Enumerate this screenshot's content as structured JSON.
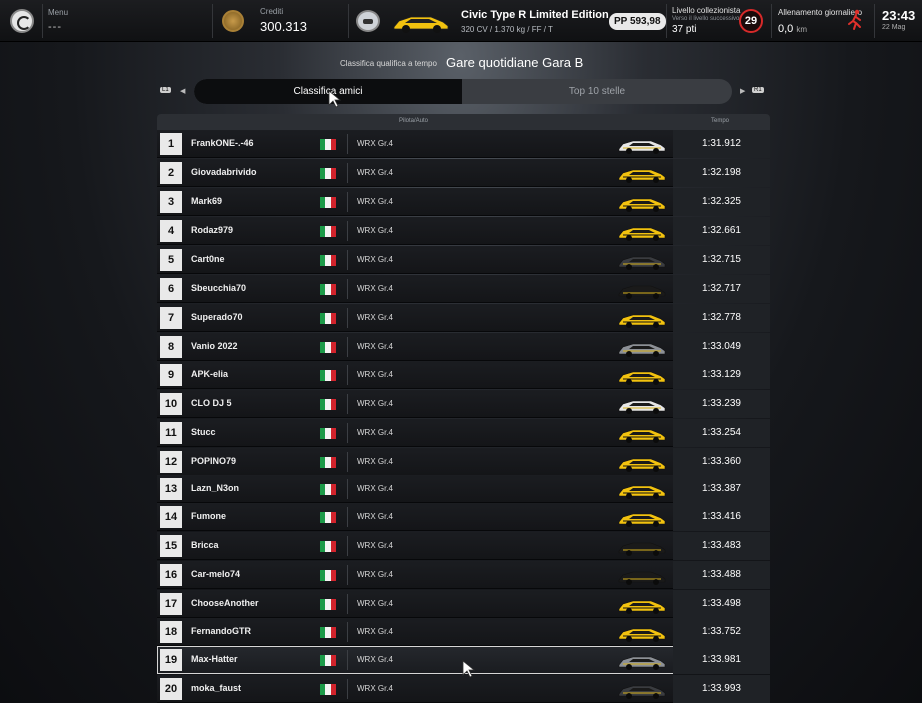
{
  "topbar": {
    "menu_label": "Menu",
    "menu_value": "---",
    "credits_label": "Crediti",
    "credits_value": "300.313",
    "car_name": "Civic Type R Limited Edition ...",
    "car_specs": "320 CV / 1.370 kg / FF / T",
    "pp_value": "PP 593,98",
    "collector_title": "Livello collezionista",
    "collector_sub": "Verso il livello successivo",
    "collector_points": "37 pti",
    "collector_level": "29",
    "training_label": "Allenamento giornaliero",
    "training_value": "0,0",
    "training_unit": "km",
    "clock_time": "23:43",
    "clock_date": "22 Mag"
  },
  "header": {
    "subtitle": "Classifica qualifica a tempo",
    "title": "Gare quotidiane Gara B"
  },
  "tabs": {
    "friends": "Classifica amici",
    "top10": "Top 10 stelle",
    "left_key": "L1",
    "right_key": "R1"
  },
  "table": {
    "col_driver": "Pilota/Auto",
    "col_time": "Tempo",
    "rows": [
      {
        "pos": "1",
        "name": "FrankONE-.-46",
        "car": "WRX Gr.4",
        "time": "1:31.912",
        "livery": "white"
      },
      {
        "pos": "2",
        "name": "Giovadabrivido",
        "car": "WRX Gr.4",
        "time": "1:32.198",
        "livery": "yellow"
      },
      {
        "pos": "3",
        "name": "Mark69",
        "car": "WRX Gr.4",
        "time": "1:32.325",
        "livery": "yellow"
      },
      {
        "pos": "4",
        "name": "Rodaz979",
        "car": "WRX Gr.4",
        "time": "1:32.661",
        "livery": "yellow"
      },
      {
        "pos": "5",
        "name": "Cart0ne",
        "car": "WRX Gr.4",
        "time": "1:32.715",
        "livery": "dark"
      },
      {
        "pos": "6",
        "name": "Sbeucchia70",
        "car": "WRX Gr.4",
        "time": "1:32.717",
        "livery": "black"
      },
      {
        "pos": "7",
        "name": "Superado70",
        "car": "WRX Gr.4",
        "time": "1:32.778",
        "livery": "yellow"
      },
      {
        "pos": "8",
        "name": "Vanio 2022",
        "car": "WRX Gr.4",
        "time": "1:33.049",
        "livery": "grey"
      },
      {
        "pos": "9",
        "name": "APK-elia",
        "car": "WRX Gr.4",
        "time": "1:33.129",
        "livery": "yellow"
      },
      {
        "pos": "10",
        "name": "CLO DJ 5",
        "car": "WRX Gr.4",
        "time": "1:33.239",
        "livery": "white"
      },
      {
        "pos": "11",
        "name": "Stucc",
        "car": "WRX Gr.4",
        "time": "1:33.254",
        "livery": "yellow"
      },
      {
        "pos": "12",
        "name": "POPINO79",
        "car": "WRX Gr.4",
        "time": "1:33.360",
        "livery": "yellow"
      },
      {
        "pos": "13",
        "name": "Lazn_N3on",
        "car": "WRX Gr.4",
        "time": "1:33.387",
        "livery": "yellow"
      },
      {
        "pos": "14",
        "name": "Fumone",
        "car": "WRX Gr.4",
        "time": "1:33.416",
        "livery": "yellow"
      },
      {
        "pos": "15",
        "name": "Bricca",
        "car": "WRX Gr.4",
        "time": "1:33.483",
        "livery": "black"
      },
      {
        "pos": "16",
        "name": "Car-melo74",
        "car": "WRX Gr.4",
        "time": "1:33.488",
        "livery": "black"
      },
      {
        "pos": "17",
        "name": "ChooseAnother",
        "car": "WRX Gr.4",
        "time": "1:33.498",
        "livery": "yellow"
      },
      {
        "pos": "18",
        "name": "FernandoGTR",
        "car": "WRX Gr.4",
        "time": "1:33.752",
        "livery": "yellow"
      },
      {
        "pos": "19",
        "name": "Max-Hatter",
        "car": "WRX Gr.4",
        "time": "1:33.981",
        "livery": "grey"
      },
      {
        "pos": "20",
        "name": "moka_faust",
        "car": "WRX Gr.4",
        "time": "1:33.993",
        "livery": "dark"
      }
    ],
    "selected_pos": "19"
  },
  "colors": {
    "accent_red": "#d62a2a",
    "flag_green": "#1c9a48",
    "flag_white": "#f4f4f4",
    "flag_red": "#d2232c",
    "livery_yellow": "#f2c20f",
    "livery_white": "#e6e6e6",
    "livery_grey": "#8c9096",
    "livery_dark": "#3a3c40",
    "livery_black": "#1a1a1a"
  }
}
